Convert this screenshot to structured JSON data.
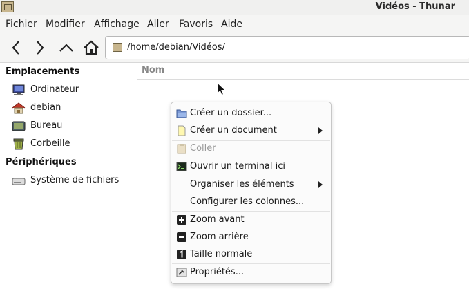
{
  "window": {
    "title": "Vidéos - Thunar"
  },
  "menubar": {
    "items": [
      "Fichier",
      "Modifier",
      "Affichage",
      "Aller",
      "Favoris",
      "Aide"
    ]
  },
  "toolbar": {
    "icons": [
      "back-arrow-icon",
      "forward-arrow-icon",
      "up-arrow-icon",
      "home-icon"
    ],
    "address": "/home/debian/Vidéos/"
  },
  "sidebar": {
    "sections": [
      {
        "title": "Emplacements",
        "items": [
          {
            "label": "Ordinateur",
            "icon": "computer-icon"
          },
          {
            "label": "debian",
            "icon": "home-folder-icon"
          },
          {
            "label": "Bureau",
            "icon": "desktop-icon"
          },
          {
            "label": "Corbeille",
            "icon": "trash-icon"
          }
        ]
      },
      {
        "title": "Périphériques",
        "items": [
          {
            "label": "Système de fichiers",
            "icon": "drive-icon"
          }
        ]
      }
    ]
  },
  "main": {
    "column_header": "Nom"
  },
  "context_menu": {
    "items": [
      {
        "label": "Créer un dossier...",
        "icon": "new-folder-icon",
        "enabled": true
      },
      {
        "label": "Créer un document",
        "icon": "new-document-icon",
        "enabled": true,
        "submenu": true
      },
      {
        "label": "Coller",
        "icon": "paste-icon",
        "enabled": false
      },
      {
        "label": "Ouvrir un terminal ici",
        "icon": "terminal-icon",
        "enabled": true
      },
      {
        "label": "Organiser les éléments",
        "enabled": true,
        "submenu": true
      },
      {
        "label": "Configurer les colonnes...",
        "enabled": true
      },
      {
        "label": "Zoom avant",
        "icon": "zoom-in-icon",
        "enabled": true
      },
      {
        "label": "Zoom arrière",
        "icon": "zoom-out-icon",
        "enabled": true
      },
      {
        "label": "Taille normale",
        "icon": "zoom-reset-icon",
        "enabled": true
      },
      {
        "label": "Propriétés...",
        "icon": "properties-icon",
        "enabled": true
      }
    ]
  },
  "colors": {
    "window_bg": "#f5f5f4",
    "menu_bg": "#fbfbfb",
    "disabled_text": "#9a9a9a",
    "folder": "#c8b68e"
  }
}
